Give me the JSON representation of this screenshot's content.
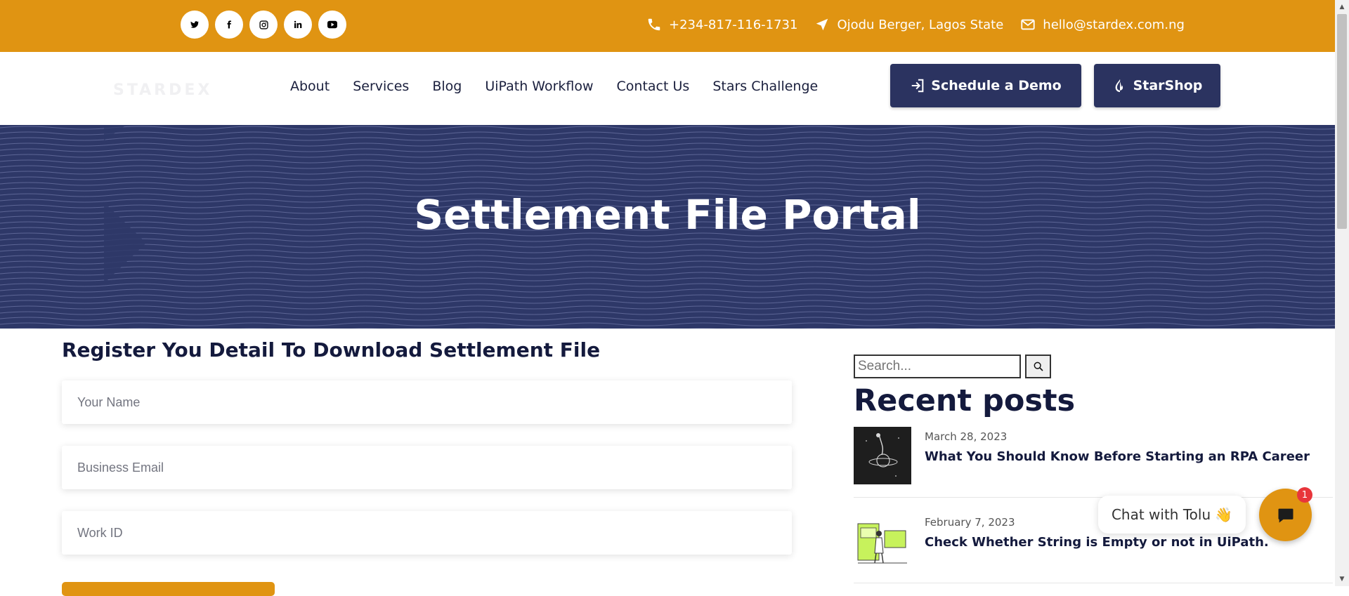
{
  "social": {
    "icons": [
      "twitter-icon",
      "facebook-icon",
      "instagram-icon",
      "linkedin-icon",
      "youtube-icon"
    ],
    "glyphs": [
      "🐦",
      "f",
      "◎",
      "in",
      "▶"
    ]
  },
  "contact": {
    "phone": "+234-817-116-1731",
    "location": "Ojodu Berger, Lagos State",
    "email": "hello@stardex.com.ng"
  },
  "header": {
    "logo": "STARDEX",
    "nav": [
      "About",
      "Services",
      "Blog",
      "UiPath Workflow",
      "Contact Us",
      "Stars Challenge"
    ],
    "demo_label": "Schedule a Demo",
    "shop_label": "StarShop"
  },
  "hero": {
    "title": "Settlement File Portal"
  },
  "form": {
    "title": "Register You Detail To Download Settlement File",
    "name_placeholder": "Your Name",
    "email_placeholder": "Business Email",
    "workid_placeholder": "Work ID"
  },
  "sidebar": {
    "search_placeholder": "Search...",
    "recent_title": "Recent posts",
    "posts": [
      {
        "date": "March 28, 2023",
        "title": "What You Should Know Before Starting an RPA Career"
      },
      {
        "date": "February 7, 2023",
        "title": "Check Whether String is Empty or not in UiPath."
      }
    ]
  },
  "chat": {
    "label": "Chat with Tolu",
    "emoji": "👋",
    "badge": "1"
  },
  "colors": {
    "accent": "#e09412",
    "navy": "#2b3360",
    "hero_bg": "#2e3868"
  }
}
